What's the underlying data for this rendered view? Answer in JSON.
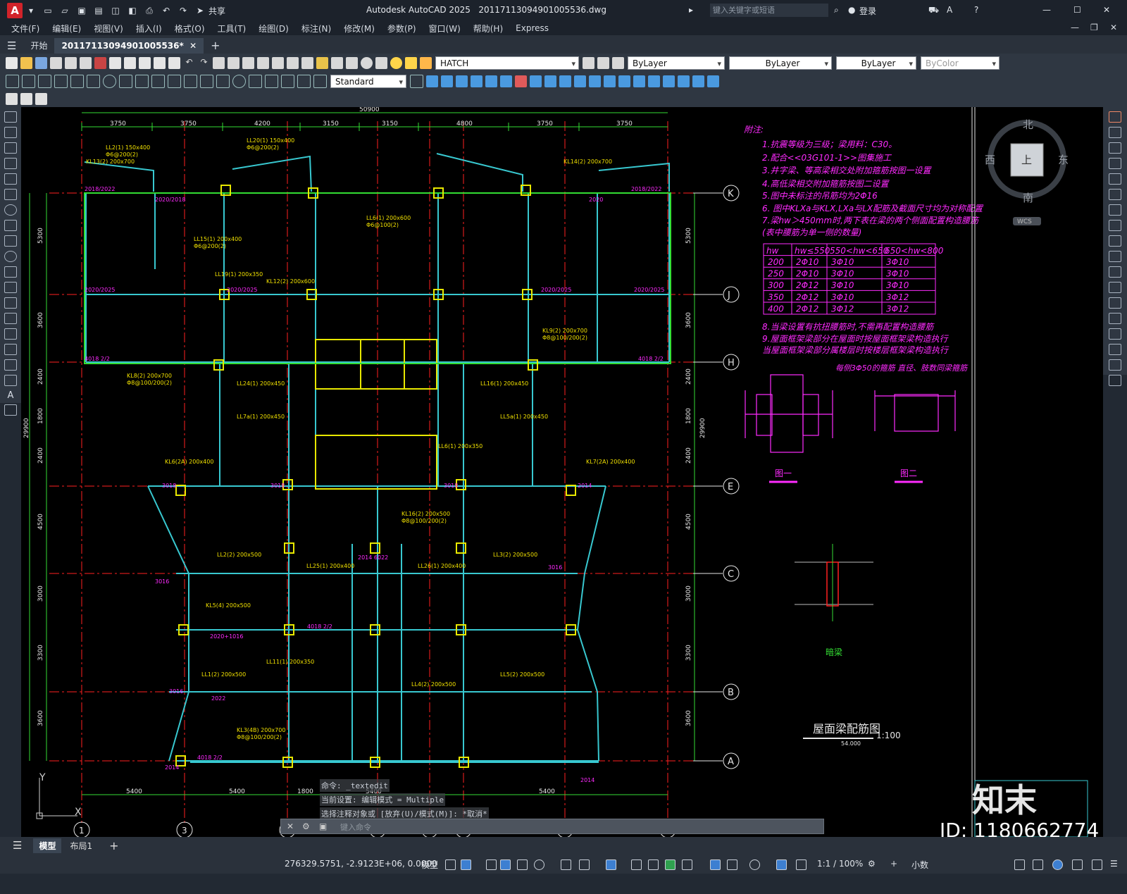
{
  "app": {
    "logo": "A",
    "title": "Autodesk AutoCAD 2025",
    "filename": "20117113094901005536.dwg",
    "share": "共享",
    "search_placeholder": "键入关键字或短语",
    "login": "登录"
  },
  "menus": [
    "文件(F)",
    "编辑(E)",
    "视图(V)",
    "插入(I)",
    "格式(O)",
    "工具(T)",
    "绘图(D)",
    "标注(N)",
    "修改(M)",
    "参数(P)",
    "窗口(W)",
    "帮助(H)",
    "Express"
  ],
  "tabs": {
    "start": "开始",
    "drawing": "20117113094901005536*",
    "add": "+"
  },
  "toolbar": {
    "hatch_layer": "HATCH",
    "text_style": "Standard",
    "color": "ByLayer",
    "linetype": "ByLayer",
    "lineweight": "ByLayer",
    "plotstyle": "ByColor"
  },
  "drawing": {
    "top_total": "50900",
    "top_dims": [
      "3750",
      "3750",
      "4200",
      "3150",
      "3150",
      "4800",
      "3750",
      "3750"
    ],
    "bottom_dims": [
      "5400",
      "5400",
      "1800",
      "5400",
      "5400"
    ],
    "left_dims": [
      "5300",
      "3600",
      "2400",
      "1800",
      "2400",
      "4500",
      "3000",
      "3300",
      "3600"
    ],
    "left_total": "29900",
    "right_total": "29900",
    "row_axes": [
      "K",
      "J",
      "H",
      "E",
      "C",
      "B",
      "A"
    ],
    "col_axes": [
      "1",
      "3",
      "4",
      "7",
      "9",
      "10",
      "11",
      "13"
    ],
    "notes_title": "附注:",
    "notes": [
      "1.抗震等级为三级；梁用料：C30。",
      "2.配合<<03G101-1>>图集施工",
      "3.井字梁、等高梁相交处附加箍筋按图一设置",
      "4.高低梁相交附加箍筋按图二设置",
      "5.图中未标注的吊筋均为2Φ16",
      "6. 图中KLXa与KLX,LXa与LX配筋及截面尺寸均为对称配置",
      "7.梁hw＞450mm时,两下表在梁的两个侧面配置构造腰筋",
      "(表中腰筋为单一侧的数量)"
    ],
    "table_head": [
      "hw",
      "hw≤550",
      "550<hw<650",
      "650<hw<800"
    ],
    "table_rows": [
      [
        "200",
        "2Φ10",
        "3Φ10",
        "3Φ10"
      ],
      [
        "250",
        "2Φ10",
        "3Φ10",
        "3Φ10"
      ],
      [
        "300",
        "2Φ12",
        "3Φ10",
        "3Φ10"
      ],
      [
        "350",
        "2Φ12",
        "3Φ10",
        "3Φ12"
      ],
      [
        "400",
        "2Φ12",
        "3Φ12",
        "3Φ12"
      ]
    ],
    "notes2": [
      "8.当梁设置有抗扭腰筋时,不需再配置构造腰筋",
      "9.屋面框架梁部分在屋面时按屋面框架梁构造执行",
      "  当屋面框架梁部分属楼层时按楼层框架梁构造执行"
    ],
    "detail_note": "每侧3Φ50的箍筋\n直径、肢数同梁箍筋",
    "fig1": "图一",
    "fig2": "图二",
    "hidden_beam": "暗梁",
    "plan_title": "屋面梁配筋图",
    "plan_scale": "1:100",
    "plan_elev": "54.000",
    "compass": {
      "n": "北",
      "s": "南",
      "e": "东",
      "w": "西",
      "top": "上",
      "wcs": "WCS"
    },
    "ucs_y": "Y",
    "ucs_x": "X",
    "watermark": "知末",
    "id_label": "ID: 1180662774"
  },
  "command": {
    "lines": [
      "命令: _textedit",
      "当前设置: 编辑模式 = Multiple",
      "选择注释对象或 [放弃(U)/模式(M)]: *取消*"
    ],
    "prompt": "键入命令"
  },
  "layout_tabs": {
    "model": "模型",
    "layout1": "布局1",
    "add": "+"
  },
  "status": {
    "coords": "276329.5751, -2.9123E+06, 0.0000",
    "model": "模型",
    "scale": "1:1 / 100%",
    "units": "小数"
  },
  "colors": {
    "beam_label": "#f0e000",
    "magenta": "#ff2bff",
    "grid": "#ff2020",
    "column": "#e8e800",
    "dim": "#33dd33",
    "wall": "#38c8d0"
  }
}
